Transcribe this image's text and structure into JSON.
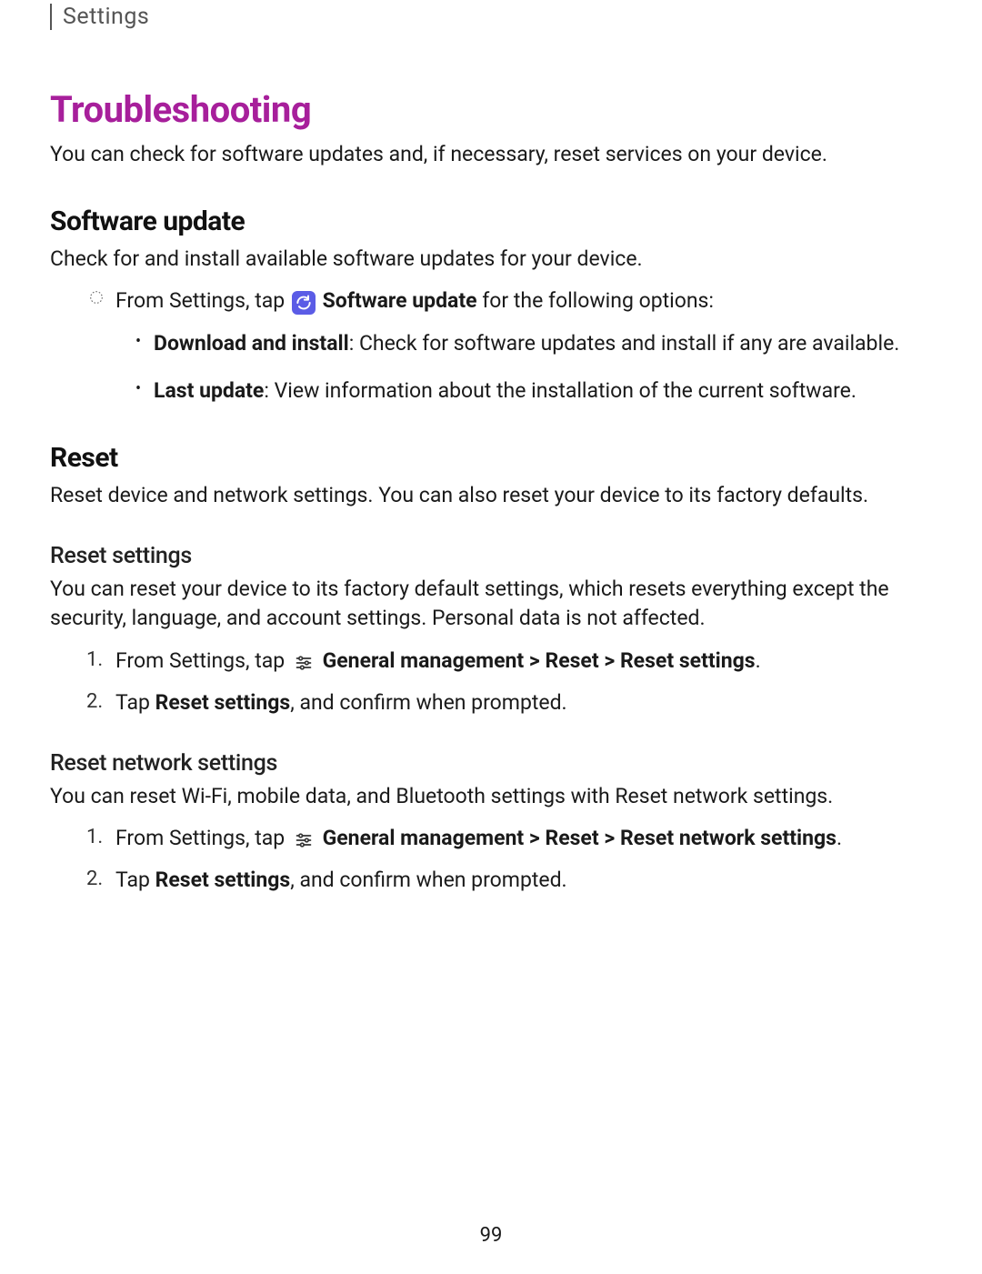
{
  "breadcrumb": "Settings",
  "title": "Troubleshooting",
  "intro": "You can check for software updates and, if necessary, reset services on your device.",
  "software_update": {
    "heading": "Software update",
    "desc": "Check for and install available software updates for your device.",
    "step_prefix": "From Settings, tap ",
    "step_bold": "Software update",
    "step_suffix": " for the following options:",
    "bullets": [
      {
        "bold": "Download and install",
        "text": ": Check for software updates and install if any are available."
      },
      {
        "bold": "Last update",
        "text": ": View information about the installation of the current software."
      }
    ]
  },
  "reset": {
    "heading": "Reset",
    "desc": "Reset device and network settings. You can also reset your device to its factory defaults.",
    "reset_settings": {
      "heading": "Reset settings",
      "desc": "You can reset your device to its factory default settings, which resets everything except the security, language, and account settings. Personal data is not affected.",
      "steps": [
        {
          "num": "1.",
          "prefix": "From Settings, tap ",
          "bold": "General management > Reset > Reset settings",
          "suffix": "."
        },
        {
          "num": "2.",
          "prefix": "Tap ",
          "bold": "Reset settings",
          "suffix": ", and confirm when prompted."
        }
      ]
    },
    "reset_network": {
      "heading": "Reset network settings",
      "desc": "You can reset Wi-Fi, mobile data, and Bluetooth settings with Reset network settings.",
      "steps": [
        {
          "num": "1.",
          "prefix": "From Settings, tap ",
          "bold": "General management > Reset > Reset network settings",
          "suffix": "."
        },
        {
          "num": "2.",
          "prefix": "Tap ",
          "bold": "Reset settings",
          "suffix": ", and confirm when prompted."
        }
      ]
    }
  },
  "page_number": "99"
}
